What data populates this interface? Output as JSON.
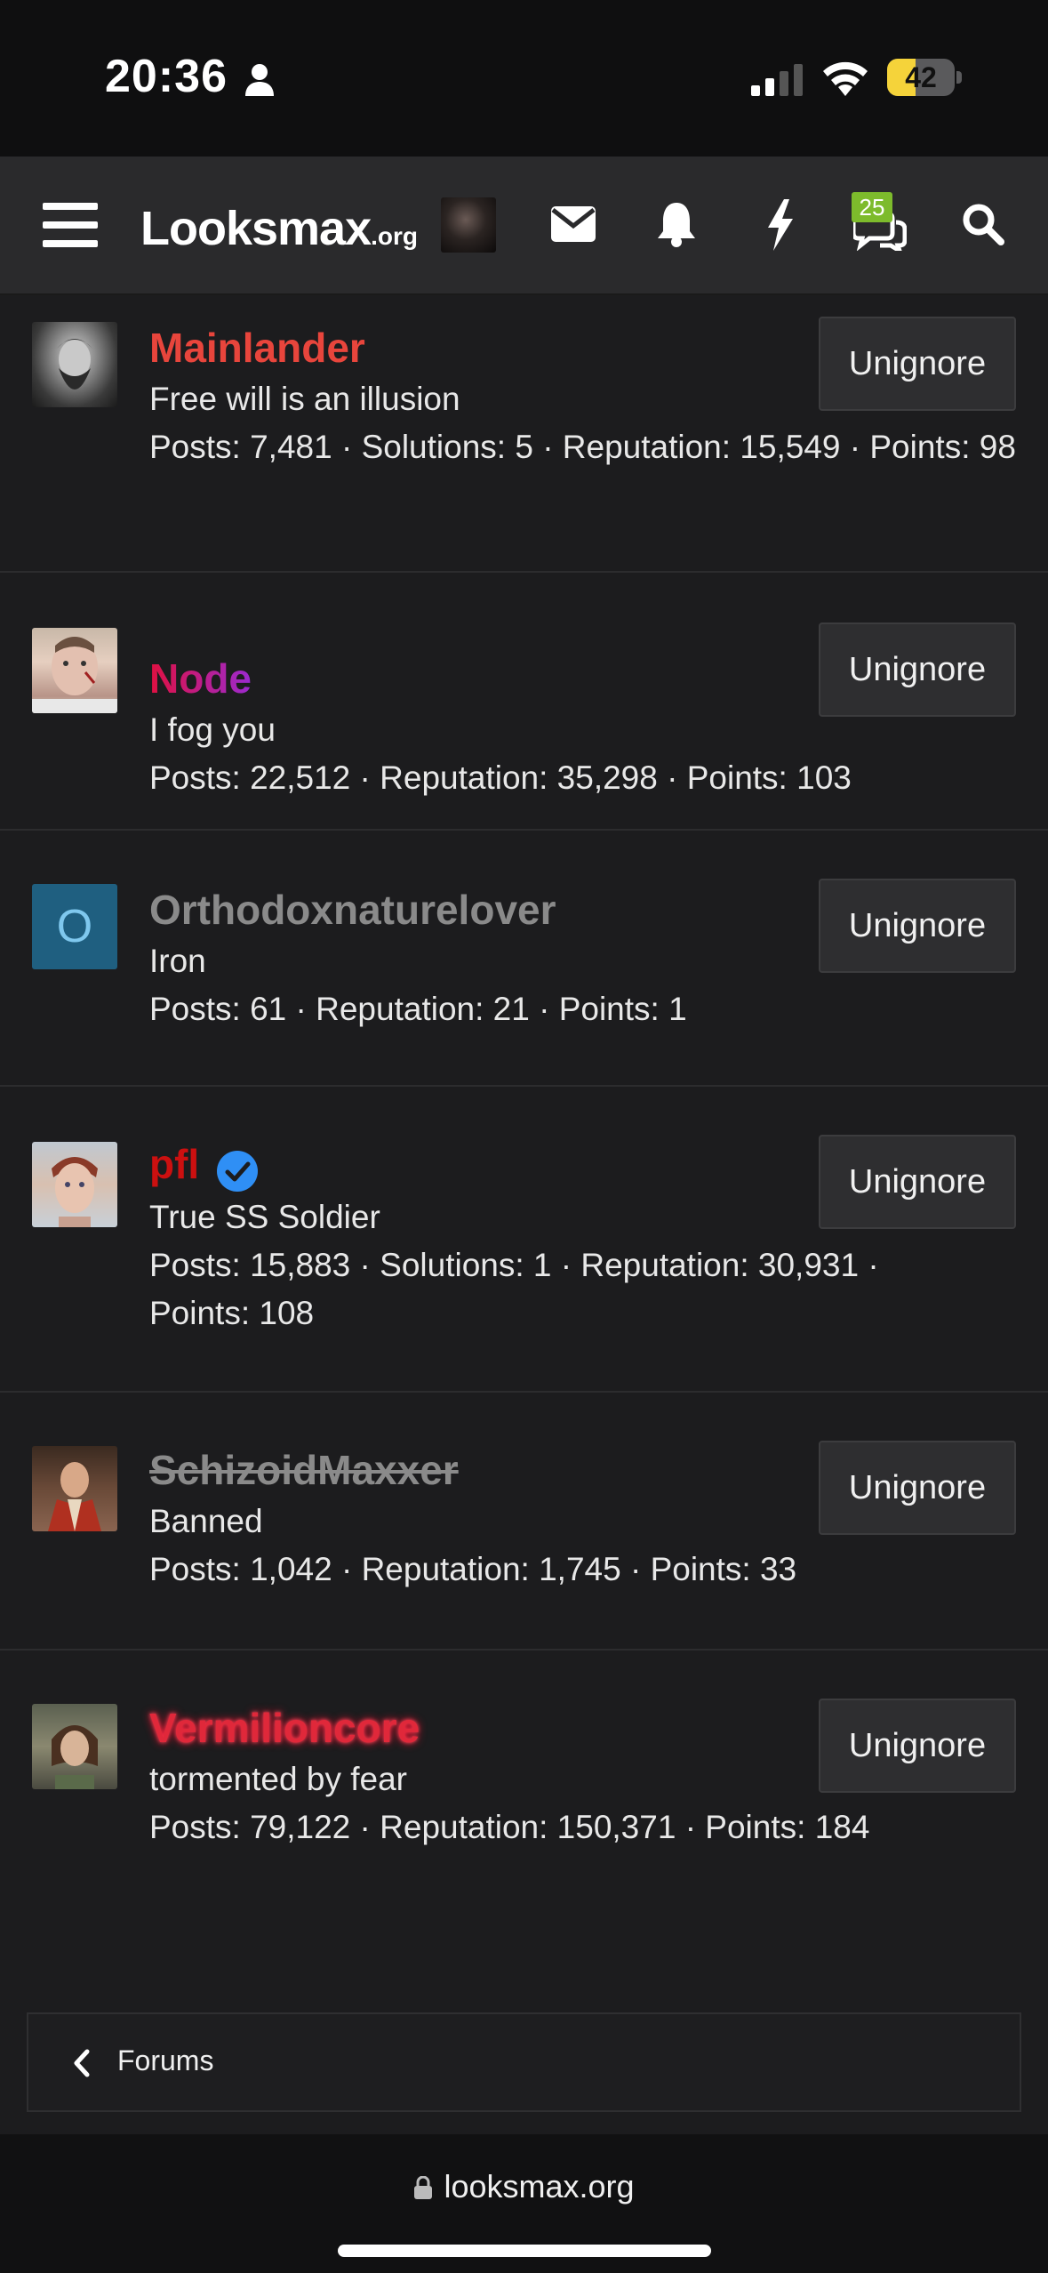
{
  "status_bar": {
    "time": "20:36",
    "battery_level": "42",
    "battery_fraction": 0.42
  },
  "nav": {
    "logo_main": "Looksmax",
    "logo_sub": ".org",
    "chat_badge": "25"
  },
  "members": [
    {
      "name": "Mainlander",
      "title": "Free will is an illusion",
      "stats": "Posts: 7,481 · Solutions: 5 · Reputation: 15,549 · Points: 98",
      "button": "Unignore"
    },
    {
      "name": "Node",
      "title": "I fog you",
      "stats": "Posts: 22,512 · Reputation: 35,298 · Points: 103",
      "button": "Unignore"
    },
    {
      "name": "Orthodoxnaturelover",
      "title": "Iron",
      "stats": "Posts: 61 · Reputation: 21 · Points: 1",
      "button": "Unignore",
      "avatar_letter": "O"
    },
    {
      "name": "pfl",
      "title": "True SS Soldier",
      "stats": "Posts: 15,883 · Solutions: 1 · Reputation: 30,931 · Points: 108",
      "button": "Unignore"
    },
    {
      "name": "SchizoidMaxxer",
      "title": "Banned",
      "stats": "Posts: 1,042 · Reputation: 1,745 · Points: 33",
      "button": "Unignore"
    },
    {
      "name": "Vermilioncore",
      "title": "tormented by fear",
      "stats": "Posts: 79,122 · Reputation: 150,371 · Points: 184",
      "button": "Unignore"
    }
  ],
  "breadcrumb": {
    "label": "Forums"
  },
  "browser": {
    "url": "looksmax.org"
  },
  "colors": {
    "badge": "#7dbb2c",
    "battery": "#f5d33a",
    "verified": "#2f8ff5",
    "avatar_o_bg": "#1f5f80"
  }
}
